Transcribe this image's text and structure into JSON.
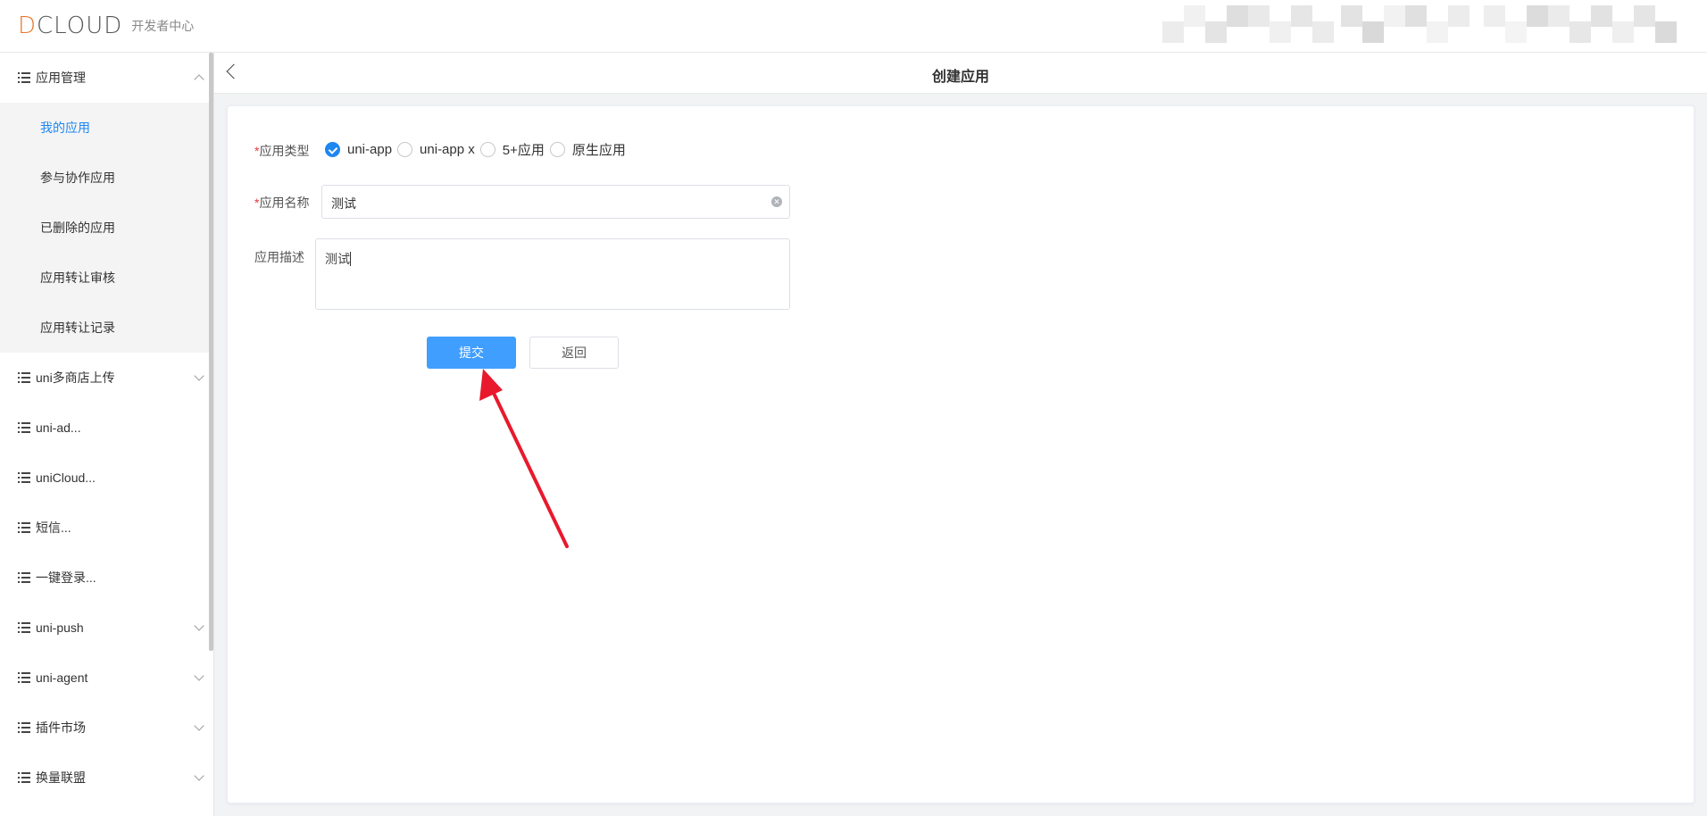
{
  "header": {
    "logo_text": "DCLOUD",
    "logo_sub": "开发者中心"
  },
  "sidebar": {
    "groups": [
      {
        "label": "应用管理",
        "expanded": true
      },
      {
        "label": "uni多商店上传"
      },
      {
        "label": "uni-ad..."
      },
      {
        "label": "uniCloud..."
      },
      {
        "label": "短信..."
      },
      {
        "label": "一键登录..."
      },
      {
        "label": "uni-push"
      },
      {
        "label": "uni-agent"
      },
      {
        "label": "插件市场"
      },
      {
        "label": "换量联盟"
      }
    ],
    "subitems": [
      {
        "label": "我的应用",
        "active": true
      },
      {
        "label": "参与协作应用"
      },
      {
        "label": "已删除的应用"
      },
      {
        "label": "应用转让审核"
      },
      {
        "label": "应用转让记录"
      }
    ]
  },
  "topbar": {
    "title": "创建应用"
  },
  "form": {
    "type_label": "应用类型",
    "name_label": "应用名称",
    "desc_label": "应用描述",
    "required_mark": "*",
    "types": [
      "uni-app",
      "uni-app x",
      "5+应用",
      "原生应用"
    ],
    "selected_type": "uni-app",
    "name_value": "测试",
    "desc_value": "测试",
    "submit_label": "提交",
    "back_label": "返回"
  },
  "colors": {
    "primary": "#409eff",
    "active_text": "#1e87f0",
    "logo_accent": "#e8772e",
    "annotation_arrow": "#e8192c"
  }
}
